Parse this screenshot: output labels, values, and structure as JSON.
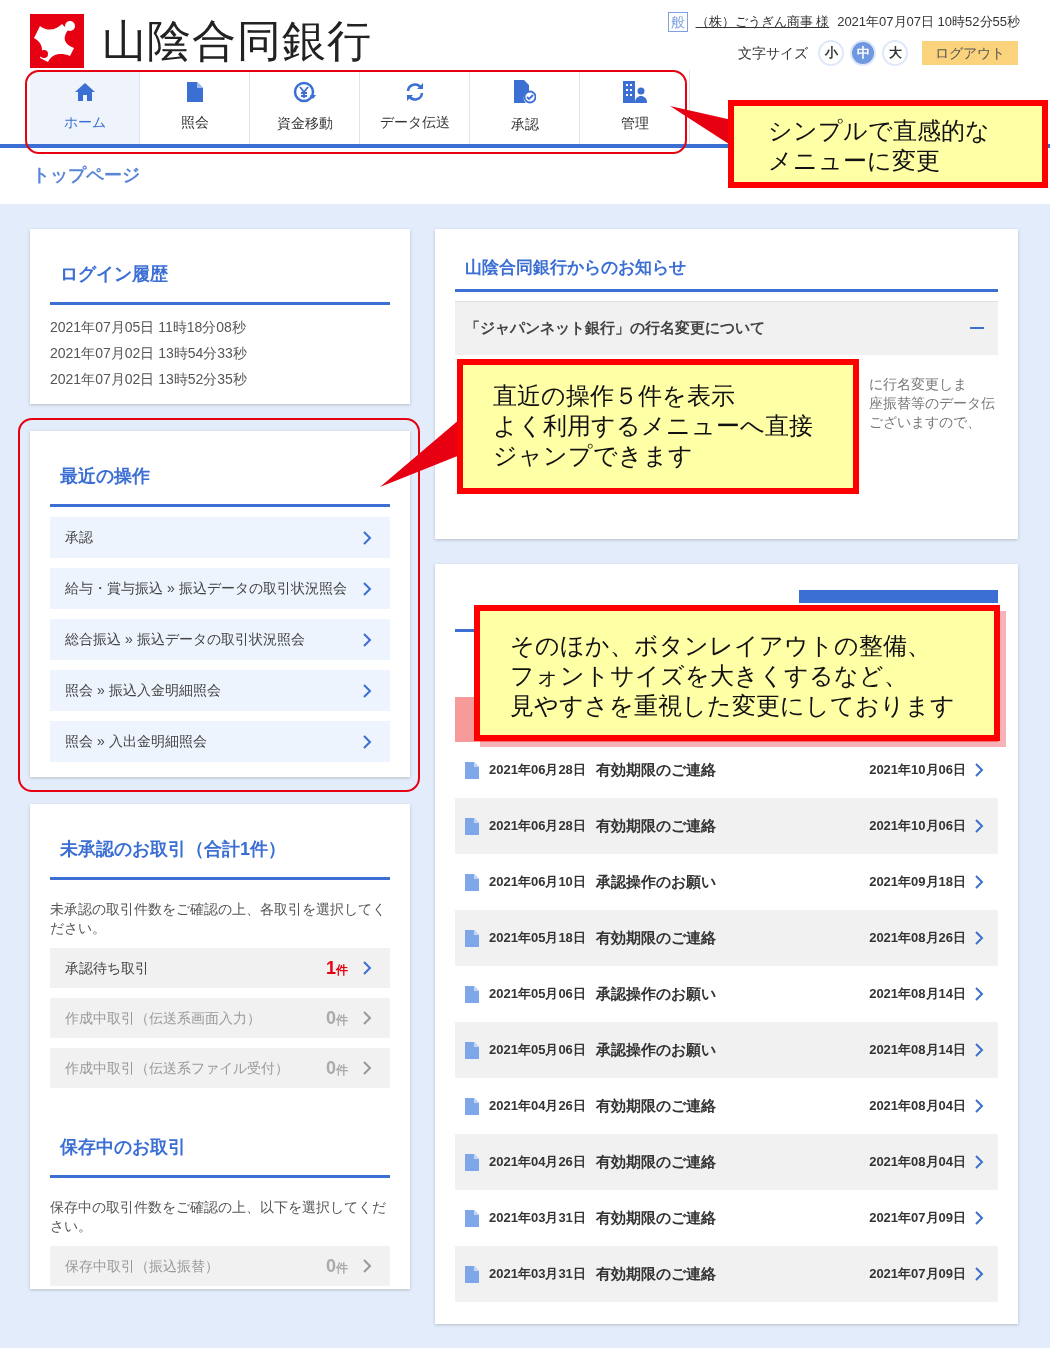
{
  "header": {
    "bank_name": "山陰合同銀行",
    "user_badge": "般",
    "user_name": "（株）ごうぎん商事 様",
    "datetime": "2021年07月07日 10時52分55秒",
    "font_size_label": "文字サイズ",
    "font_sizes": [
      {
        "label": "小",
        "selected": false
      },
      {
        "label": "中",
        "selected": true
      },
      {
        "label": "大",
        "selected": false
      }
    ],
    "logout": "ログアウト"
  },
  "nav": [
    {
      "label": "ホーム",
      "selected": true
    },
    {
      "label": "照会",
      "selected": false
    },
    {
      "label": "資金移動",
      "selected": false
    },
    {
      "label": "データ伝送",
      "selected": false
    },
    {
      "label": "承認",
      "selected": false
    },
    {
      "label": "管理",
      "selected": false
    }
  ],
  "breadcrumb": "トップページ",
  "login_history": {
    "title": "ログイン履歴",
    "entries": [
      "2021年07月05日 11時18分08秒",
      "2021年07月02日 13時54分33秒",
      "2021年07月02日 13時52分35秒"
    ]
  },
  "recent_operations": {
    "title": "最近の操作",
    "items": [
      "承認",
      "給与・賞与振込 » 振込データの取引状況照会",
      "総合振込 » 振込データの取引状況照会",
      "照会 » 振込入金明細照会",
      "照会 » 入出金明細照会"
    ]
  },
  "pending": {
    "title": "未承認のお取引（合計1件）",
    "description": "未承認の取引件数をご確認の上、各取引を選択してください。",
    "items": [
      {
        "label": "承認待ち取引",
        "count": "1",
        "unit": "件",
        "disabled": false
      },
      {
        "label": "作成中取引（伝送系画面入力）",
        "count": "0",
        "unit": "件",
        "disabled": true
      },
      {
        "label": "作成中取引（伝送系ファイル受付）",
        "count": "0",
        "unit": "件",
        "disabled": true
      }
    ]
  },
  "saved": {
    "title": "保存中のお取引",
    "description": "保存中の取引件数をご確認の上、以下を選択してください。",
    "items": [
      {
        "label": "保存中取引（振込振替）",
        "count": "0",
        "unit": "件",
        "disabled": true
      }
    ]
  },
  "notices": {
    "title": "山陰合同銀行からのお知らせ",
    "items": [
      {
        "title": "「ジャパンネット銀行」の行名変更について",
        "expanded": true,
        "body_lines": [
          "に行名変更しま",
          "座振替等のデータ伝",
          "ございますので、"
        ]
      }
    ]
  },
  "news": {
    "rows": [
      {
        "date": "2021年06月28日",
        "title": "有効期限のご連絡",
        "deadline": "2021年10月06日"
      },
      {
        "date": "2021年06月28日",
        "title": "有効期限のご連絡",
        "deadline": "2021年10月06日"
      },
      {
        "date": "2021年06月10日",
        "title": "承認操作のお願い",
        "deadline": "2021年09月18日"
      },
      {
        "date": "2021年05月18日",
        "title": "有効期限のご連絡",
        "deadline": "2021年08月26日"
      },
      {
        "date": "2021年05月06日",
        "title": "承認操作のお願い",
        "deadline": "2021年08月14日"
      },
      {
        "date": "2021年05月06日",
        "title": "承認操作のお願い",
        "deadline": "2021年08月14日"
      },
      {
        "date": "2021年04月26日",
        "title": "有効期限のご連絡",
        "deadline": "2021年08月04日"
      },
      {
        "date": "2021年04月26日",
        "title": "有効期限のご連絡",
        "deadline": "2021年08月04日"
      },
      {
        "date": "2021年03月31日",
        "title": "有効期限のご連絡",
        "deadline": "2021年07月09日"
      },
      {
        "date": "2021年03月31日",
        "title": "有効期限のご連絡",
        "deadline": "2021年07月09日"
      }
    ]
  },
  "annotations": [
    {
      "lines": [
        "シンプルで直感的な",
        "メニューに変更"
      ]
    },
    {
      "lines": [
        "直近の操作５件を表示",
        "よく利用するメニューへ直接",
        "ジャンプできます"
      ]
    },
    {
      "lines": [
        "そのほか、ボタンレイアウトの整備、",
        "フォントサイズを大きくするなど、",
        "見やすさを重視した変更にしております"
      ]
    }
  ]
}
